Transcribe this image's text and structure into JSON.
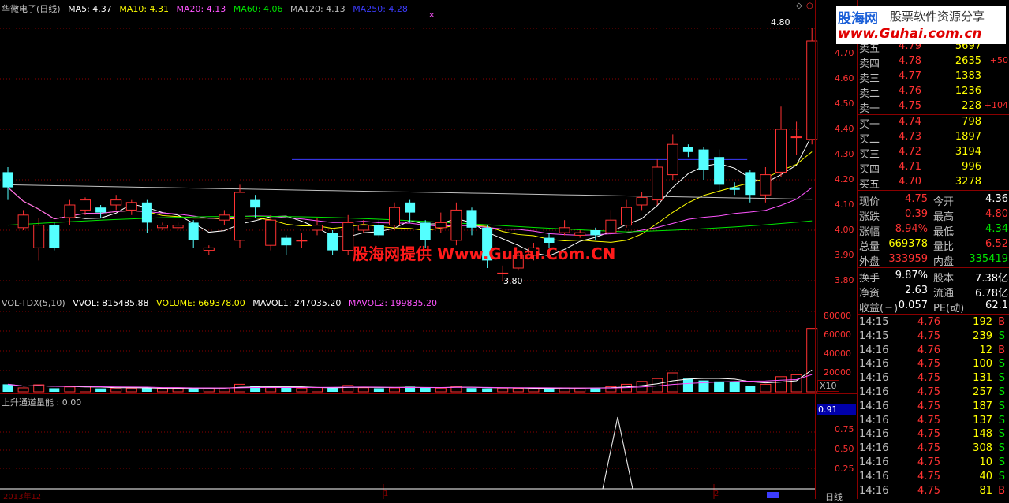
{
  "header": {
    "stock": "华微电子(日线)",
    "ma5": "MA5: 4.37",
    "ma10": "MA10: 4.31",
    "ma20": "MA20: 4.13",
    "ma60": "MA60: 4.06",
    "ma120": "MA120: 4.13",
    "ma250": "MA250: 4.28"
  },
  "high_marker": "4.80",
  "low_marker": "3.80",
  "price_axis": [
    "4.70",
    "4.60",
    "4.50",
    "4.40",
    "4.30",
    "4.20",
    "4.10",
    "4.00",
    "3.90",
    "3.80"
  ],
  "vol_header": {
    "name": "VOL-TDX(5,10)",
    "vvol": "VVOL: 815485.88",
    "volume": "VOLUME: 669378.00",
    "mavol1": "MAVOL1: 247035.20",
    "mavol2": "MAVOL2: 199835.20"
  },
  "vol_axis": [
    "80000",
    "60000",
    "40000",
    "20000"
  ],
  "vol_unit": "X10",
  "ind_header": "上升通道量能 : 0.00",
  "ind_axis": [
    "0.75",
    "0.50",
    "0.25"
  ],
  "ind_value": "0.91",
  "bottom_axis": {
    "left": "2013年12",
    "mid": "1",
    "right": "2"
  },
  "bottom_tab": "日线",
  "watermark": "股海网提供 Www.Guhai.Com.CN",
  "logo": {
    "name": "股海网",
    "slogan": "股票软件资源分享",
    "url": "www.Guhai.com.cn"
  },
  "order_book": {
    "asks": [
      {
        "label": "卖五",
        "price": "4.79",
        "vol": "5697",
        "chg": ""
      },
      {
        "label": "卖四",
        "price": "4.78",
        "vol": "2635",
        "chg": "+50"
      },
      {
        "label": "卖三",
        "price": "4.77",
        "vol": "1383",
        "chg": ""
      },
      {
        "label": "卖二",
        "price": "4.76",
        "vol": "1236",
        "chg": ""
      },
      {
        "label": "卖一",
        "price": "4.75",
        "vol": "228",
        "chg": "+104"
      }
    ],
    "bids": [
      {
        "label": "买一",
        "price": "4.74",
        "vol": "798",
        "chg": ""
      },
      {
        "label": "买二",
        "price": "4.73",
        "vol": "1897",
        "chg": ""
      },
      {
        "label": "买三",
        "price": "4.72",
        "vol": "3194",
        "chg": ""
      },
      {
        "label": "买四",
        "price": "4.71",
        "vol": "996",
        "chg": ""
      },
      {
        "label": "买五",
        "price": "4.70",
        "vol": "3278",
        "chg": ""
      }
    ]
  },
  "quote": [
    {
      "l1": "现价",
      "v1": "4.75",
      "c1": "red",
      "l2": "今开",
      "v2": "4.36",
      "c2": "white"
    },
    {
      "l1": "涨跌",
      "v1": "0.39",
      "c1": "red",
      "l2": "最高",
      "v2": "4.80",
      "c2": "red"
    },
    {
      "l1": "涨幅",
      "v1": "8.94%",
      "c1": "red",
      "l2": "最低",
      "v2": "4.34",
      "c2": "green"
    },
    {
      "l1": "总量",
      "v1": "669378",
      "c1": "yellow",
      "l2": "量比",
      "v2": "6.52",
      "c2": "red"
    },
    {
      "l1": "外盘",
      "v1": "333959",
      "c1": "red",
      "l2": "内盘",
      "v2": "335419",
      "c2": "green"
    }
  ],
  "fund": [
    {
      "l1": "换手",
      "v1": "9.87%",
      "l2": "股本",
      "v2": "7.38亿"
    },
    {
      "l1": "净资",
      "v1": "2.63",
      "l2": "流通",
      "v2": "6.78亿"
    },
    {
      "l1": "收益(三)",
      "v1": "0.057",
      "l2": "PE(动)",
      "v2": "62.1"
    }
  ],
  "ticks": [
    {
      "time": "14:15",
      "price": "4.76",
      "vol": "192",
      "bs": "B"
    },
    {
      "time": "14:15",
      "price": "4.75",
      "vol": "239",
      "bs": "S"
    },
    {
      "time": "14:16",
      "price": "4.76",
      "vol": "12",
      "bs": "B"
    },
    {
      "time": "14:16",
      "price": "4.75",
      "vol": "100",
      "bs": "S"
    },
    {
      "time": "14:16",
      "price": "4.75",
      "vol": "131",
      "bs": "S"
    },
    {
      "time": "14:16",
      "price": "4.75",
      "vol": "257",
      "bs": "S"
    },
    {
      "time": "14:16",
      "price": "4.75",
      "vol": "187",
      "bs": "S"
    },
    {
      "time": "14:16",
      "price": "4.75",
      "vol": "137",
      "bs": "S"
    },
    {
      "time": "14:16",
      "price": "4.75",
      "vol": "148",
      "bs": "S"
    },
    {
      "time": "14:16",
      "price": "4.75",
      "vol": "308",
      "bs": "S"
    },
    {
      "time": "14:16",
      "price": "4.75",
      "vol": "10",
      "bs": "S"
    },
    {
      "time": "14:16",
      "price": "4.75",
      "vol": "40",
      "bs": "S"
    },
    {
      "time": "14:16",
      "price": "4.75",
      "vol": "81",
      "bs": "B"
    }
  ],
  "colors": {
    "up": "#ff3232",
    "down": "#54ffff",
    "grid": "#8b0000",
    "ma5": "#ffffff",
    "ma10": "#ffff00",
    "ma20": "#ff55ff",
    "ma60": "#00e600",
    "ma250": "#3c3cff"
  },
  "chart_data": {
    "type": "candlestick",
    "ylim": [
      3.75,
      4.85
    ],
    "candles": [
      [
        4.23,
        4.17,
        4.25,
        4.12
      ],
      [
        4.01,
        4.06,
        4.08,
        4.0
      ],
      [
        3.93,
        4.02,
        4.05,
        3.88
      ],
      [
        4.02,
        3.93,
        4.03,
        3.92
      ],
      [
        4.05,
        4.1,
        4.12,
        4.02
      ],
      [
        4.08,
        4.12,
        4.13,
        4.06
      ],
      [
        4.09,
        4.07,
        4.1,
        4.05
      ],
      [
        4.1,
        4.12,
        4.14,
        4.08
      ],
      [
        4.08,
        4.11,
        4.12,
        4.06
      ],
      [
        4.11,
        4.03,
        4.12,
        3.99
      ],
      [
        4.01,
        4.02,
        4.03,
        4.0
      ],
      [
        4.01,
        4.02,
        4.03,
        4.0
      ],
      [
        4.03,
        3.96,
        4.04,
        3.93
      ],
      [
        3.92,
        3.93,
        3.94,
        3.9
      ],
      [
        4.04,
        4.06,
        4.08,
        4.02
      ],
      [
        3.96,
        4.15,
        4.18,
        3.93
      ],
      [
        4.12,
        4.09,
        4.14,
        4.05
      ],
      [
        3.94,
        4.04,
        4.06,
        3.92
      ],
      [
        3.97,
        3.94,
        3.98,
        3.9
      ],
      [
        3.96,
        3.96,
        3.99,
        3.93
      ],
      [
        4.0,
        4.02,
        4.05,
        3.98
      ],
      [
        3.99,
        3.92,
        4.0,
        3.9
      ],
      [
        3.92,
        4.03,
        4.06,
        3.9
      ],
      [
        4.0,
        4.02,
        4.04,
        3.99
      ],
      [
        4.02,
        3.98,
        4.04,
        3.97
      ],
      [
        4.02,
        4.09,
        4.11,
        4.0
      ],
      [
        4.11,
        4.07,
        4.12,
        4.03
      ],
      [
        4.03,
        3.96,
        4.04,
        3.93
      ],
      [
        4.01,
        4.03,
        4.07,
        3.99
      ],
      [
        3.96,
        4.08,
        4.11,
        3.94
      ],
      [
        4.08,
        4.01,
        4.09,
        3.98
      ],
      [
        4.01,
        3.88,
        4.02,
        3.85
      ],
      [
        3.83,
        3.83,
        3.86,
        3.8
      ],
      [
        3.85,
        3.9,
        3.92,
        3.84
      ],
      [
        3.9,
        3.93,
        3.95,
        3.88
      ],
      [
        3.97,
        3.95,
        3.99,
        3.93
      ],
      [
        3.99,
        4.01,
        4.04,
        3.98
      ],
      [
        3.98,
        3.99,
        4.0,
        3.97
      ],
      [
        4.0,
        3.98,
        4.01,
        3.96
      ],
      [
        3.99,
        4.04,
        4.08,
        3.98
      ],
      [
        4.02,
        4.09,
        4.12,
        4.01
      ],
      [
        4.1,
        4.13,
        4.15,
        4.08
      ],
      [
        4.12,
        4.25,
        4.28,
        4.1
      ],
      [
        4.22,
        4.34,
        4.38,
        4.2
      ],
      [
        4.33,
        4.31,
        4.34,
        4.29
      ],
      [
        4.32,
        4.24,
        4.33,
        4.2
      ],
      [
        4.29,
        4.18,
        4.32,
        4.15
      ],
      [
        4.17,
        4.16,
        4.19,
        4.14
      ],
      [
        4.23,
        4.14,
        4.24,
        4.11
      ],
      [
        4.14,
        4.22,
        4.25,
        4.11
      ],
      [
        4.23,
        4.4,
        4.49,
        4.21
      ],
      [
        4.37,
        4.37,
        4.43,
        4.3
      ],
      [
        4.36,
        4.75,
        4.8,
        4.34
      ]
    ],
    "volumes": [
      8000,
      4200,
      7500,
      3800,
      5200,
      5400,
      3600,
      4000,
      3900,
      4100,
      3500,
      3700,
      4200,
      4000,
      4100,
      8000,
      6000,
      4500,
      4200,
      4000,
      4500,
      4100,
      6800,
      4400,
      3800,
      4200,
      5500,
      5000,
      4000,
      5800,
      4000,
      3700,
      4000,
      3500,
      3600,
      4100,
      4200,
      4000,
      4200,
      5500,
      8000,
      11000,
      14000,
      20000,
      14000,
      12000,
      11000,
      10000,
      6500,
      8000,
      16000,
      18000,
      66937
    ],
    "ind_spike": 0.91
  }
}
